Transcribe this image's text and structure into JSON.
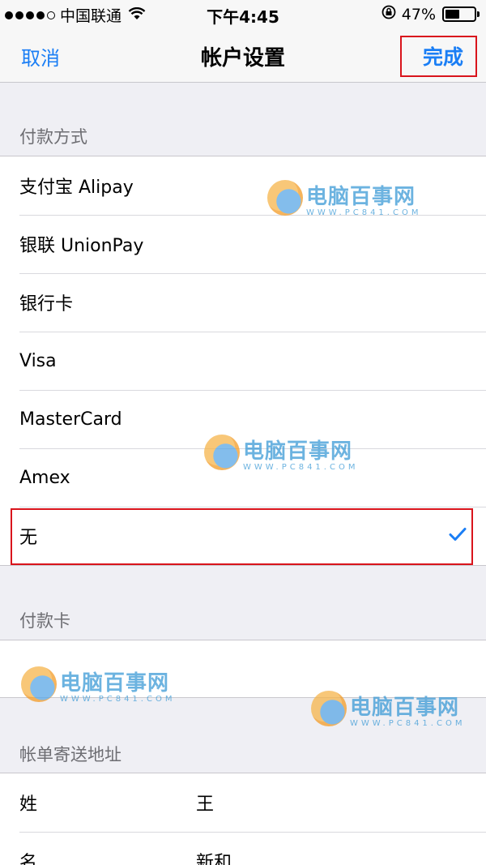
{
  "status": {
    "carrier": "中国联通",
    "time": "下午4:45",
    "battery": "47%"
  },
  "nav": {
    "cancel": "取消",
    "title": "帐户设置",
    "done": "完成"
  },
  "payment": {
    "header": "付款方式",
    "items": [
      {
        "label": "支付宝 Alipay"
      },
      {
        "label": "银联 UnionPay"
      },
      {
        "label": "银行卡"
      },
      {
        "label": "Visa"
      },
      {
        "label": "MasterCard"
      },
      {
        "label": "Amex"
      },
      {
        "label": "无",
        "selected": true
      }
    ]
  },
  "card": {
    "header": "付款卡"
  },
  "billing": {
    "header": "帐单寄送地址",
    "rows": [
      {
        "label": "姓",
        "value": "王"
      },
      {
        "label": "名",
        "value": "新和"
      }
    ]
  },
  "watermark": {
    "cn": "电脑百事网",
    "en": "WWW.PC841.COM"
  },
  "colors": {
    "accent": "#1a7ef5",
    "highlight": "#d9141c"
  }
}
